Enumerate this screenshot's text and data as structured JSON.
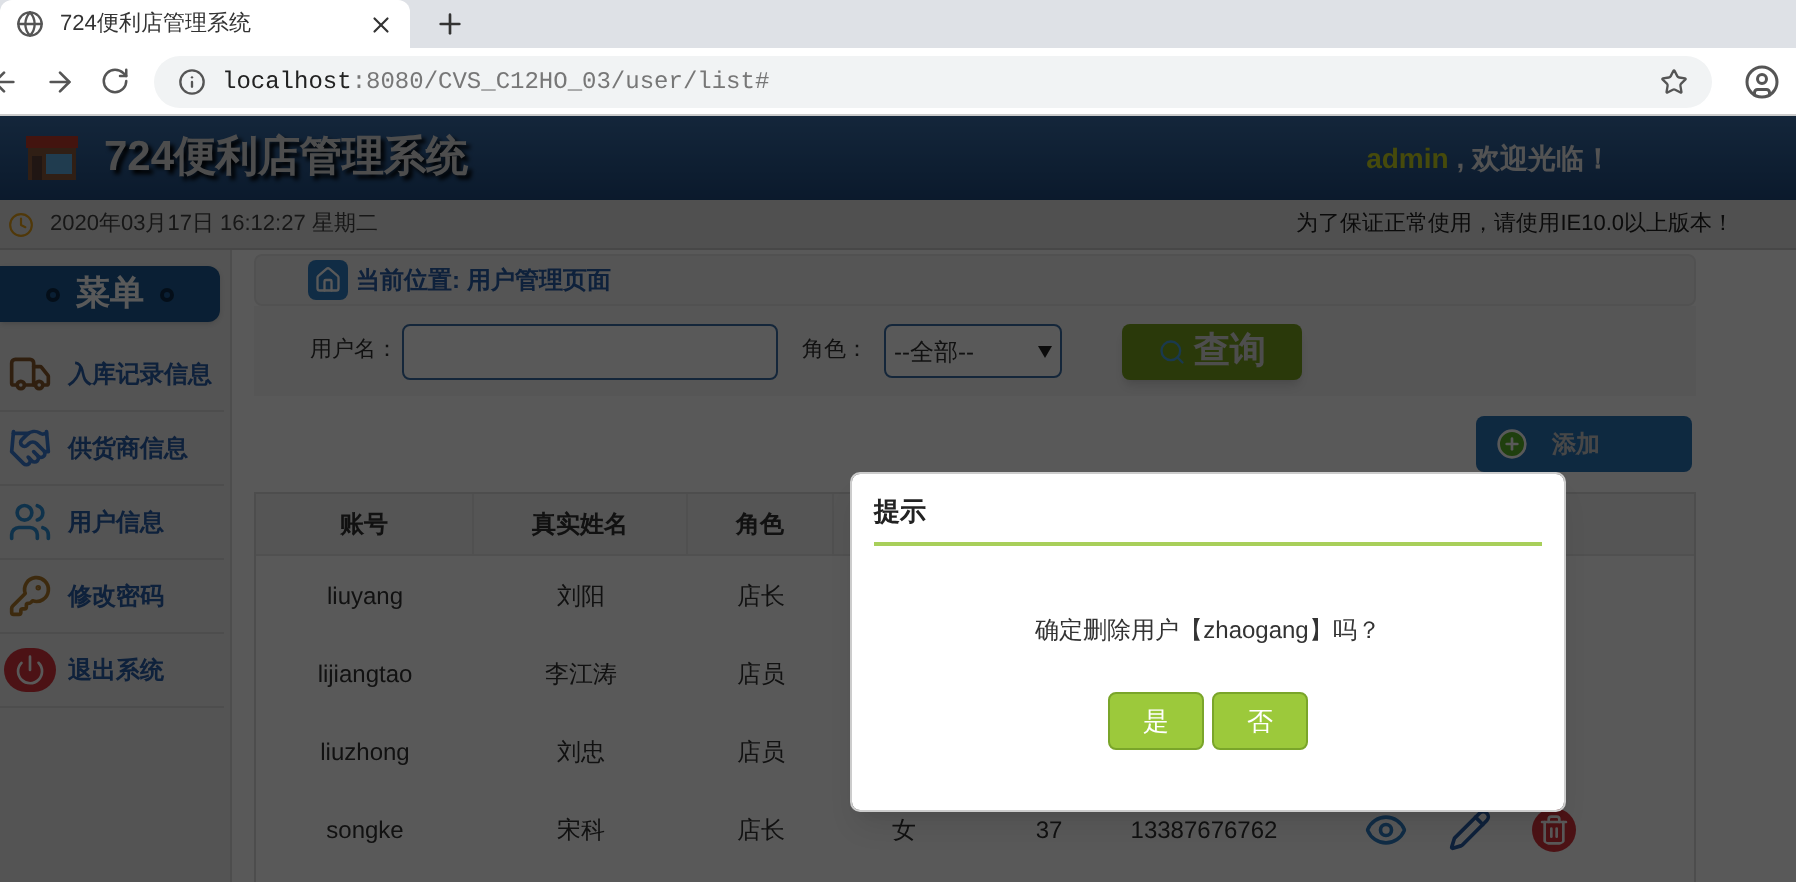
{
  "browser": {
    "tab_title": "724便利店管理系统",
    "url_host": "localhost",
    "url_path": ":8080/CVS_C12HO_03/user/list#"
  },
  "header": {
    "title": "724便利店管理系统",
    "user": "admin",
    "greeting": ", 欢迎光临！"
  },
  "info_bar": {
    "datetime": "2020年03月17日 16:12:27 星期二",
    "notice": "为了保证正常使用，请使用IE10.0以上版本！"
  },
  "sidebar": {
    "title": "菜单",
    "items": [
      {
        "label": "入库记录信息"
      },
      {
        "label": "供货商信息"
      },
      {
        "label": "用户信息"
      },
      {
        "label": "修改密码"
      },
      {
        "label": "退出系统"
      }
    ]
  },
  "breadcrumb": {
    "label": "当前位置:",
    "page": "用户管理页面"
  },
  "search": {
    "username_label": "用户名：",
    "role_label": "角色：",
    "role_value": "--全部--",
    "query_button": "查询"
  },
  "add_button": "添加",
  "table": {
    "columns": [
      "账号",
      "真实姓名",
      "角色"
    ],
    "rows": [
      {
        "cells": [
          "liuyang",
          "刘阳",
          "店长"
        ]
      },
      {
        "cells": [
          "lijiangtao",
          "李江涛",
          "店员"
        ]
      },
      {
        "cells": [
          "liuzhong",
          "刘忠",
          "店员"
        ]
      },
      {
        "cells": [
          "songke",
          "宋科",
          "店长",
          "女",
          "37",
          "13387676762"
        ],
        "actions": [
          {
            "kind": "view"
          },
          {
            "kind": "edit"
          },
          {
            "kind": "delete"
          }
        ]
      }
    ]
  },
  "dialog": {
    "title": "提示",
    "message": "确定删除用户【zhaogang】吗？",
    "buttons": [
      "是",
      "否"
    ]
  }
}
